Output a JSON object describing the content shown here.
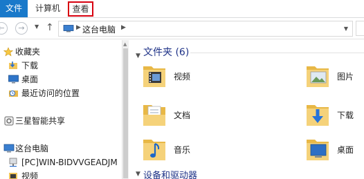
{
  "ribbon": {
    "tabs": [
      {
        "label": "文件"
      },
      {
        "label": "计算机"
      },
      {
        "label": "查看"
      }
    ]
  },
  "address": {
    "path_label": "这台电脑"
  },
  "nav": {
    "items": [
      {
        "label": "收藏夹",
        "icon": "star-icon"
      },
      {
        "label": "下载",
        "icon": "download-folder-icon"
      },
      {
        "label": "桌面",
        "icon": "desktop-icon"
      },
      {
        "label": "最近访问的位置",
        "icon": "recent-places-icon"
      },
      {
        "label": "三星智能共享",
        "icon": "share-icon"
      },
      {
        "label": "这台电脑",
        "icon": "computer-icon"
      },
      {
        "label": "[PC]WIN-BIDVVGEADJM",
        "icon": "network-drive-icon"
      },
      {
        "label": "视频",
        "icon": "videos-folder-icon"
      }
    ]
  },
  "content": {
    "folders_group_title": "文件夹 (6)",
    "folders": [
      {
        "label": "视频",
        "icon": "videos-folder-icon"
      },
      {
        "label": "图片",
        "icon": "pictures-folder-icon"
      },
      {
        "label": "文档",
        "icon": "documents-folder-icon"
      },
      {
        "label": "下载",
        "icon": "downloads-folder-icon"
      },
      {
        "label": "音乐",
        "icon": "music-folder-icon"
      },
      {
        "label": "桌面",
        "icon": "desktop-folder-icon"
      }
    ],
    "devices_group_title": "设备和驱动器"
  },
  "colors": {
    "file_tab": "#1979ca",
    "highlight_box": "#d7000f",
    "group_title": "#1e3287",
    "folder_yellow": "#f2c75c"
  }
}
